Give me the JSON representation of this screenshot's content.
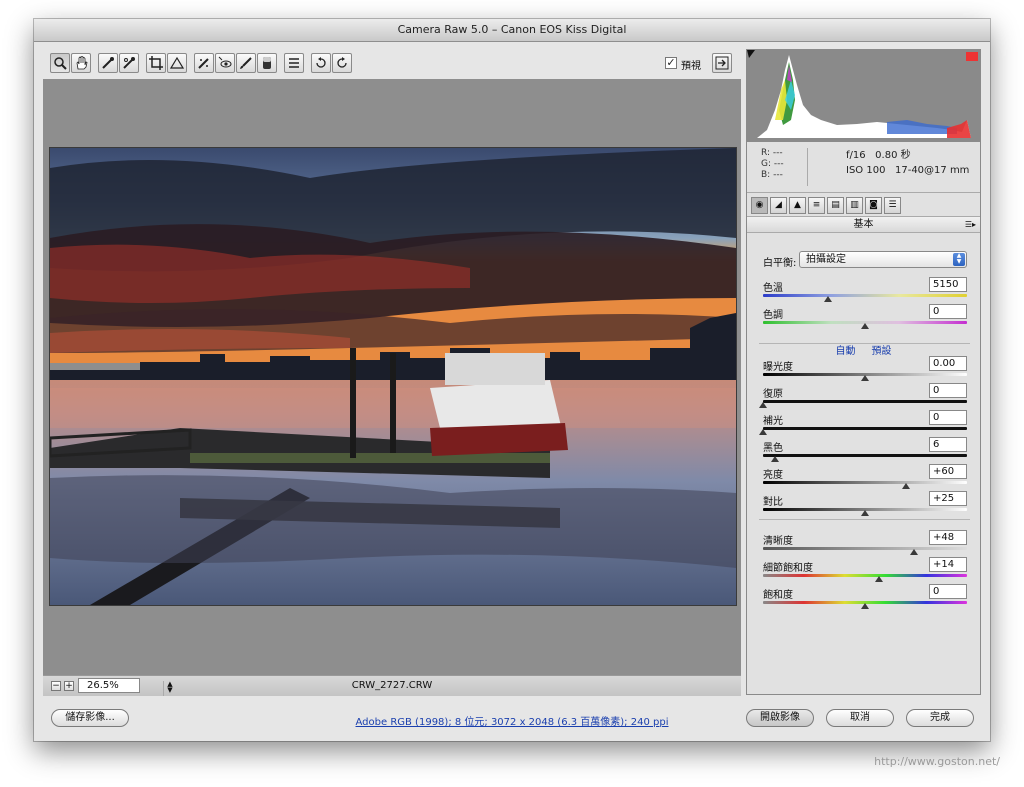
{
  "window": {
    "title": "Camera Raw 5.0  –  Canon EOS Kiss Digital"
  },
  "toolbar": {
    "tools": [
      "zoom-icon",
      "hand-icon",
      "white-balance-eyedropper-icon",
      "color-sampler-icon",
      "crop-icon",
      "straighten-icon",
      "spot-removal-icon",
      "red-eye-icon",
      "adjustment-brush-icon",
      "graduated-filter-icon",
      "preferences-icon",
      "rotate-ccw-icon",
      "rotate-cw-icon"
    ],
    "preview_label": "預視",
    "preview_checked": true
  },
  "status": {
    "zoom_minus": "−",
    "zoom_plus": "+",
    "zoom_value": "26.5%",
    "filename": "CRW_2727.CRW"
  },
  "info": {
    "r_label": "R:",
    "r_value": "---",
    "g_label": "G:",
    "g_value": "---",
    "b_label": "B:",
    "b_value": "---",
    "aperture": "f/16",
    "shutter": "0.80 秒",
    "iso": "ISO 100",
    "lens": "17-40@17 mm"
  },
  "panel": {
    "section_title": "基本",
    "wb_label": "白平衡:",
    "wb_value": "拍攝設定",
    "auto_label": "自動",
    "default_label": "預設",
    "sliders": [
      {
        "label": "色溫",
        "value": "5150",
        "position": 0.32
      },
      {
        "label": "色調",
        "value": "0",
        "position": 0.5
      },
      {
        "label": "曝光度",
        "value": "0.00",
        "position": 0.5
      },
      {
        "label": "復原",
        "value": "0",
        "position": 0.0
      },
      {
        "label": "補光",
        "value": "0",
        "position": 0.0
      },
      {
        "label": "黑色",
        "value": "6",
        "position": 0.06
      },
      {
        "label": "亮度",
        "value": "+60",
        "position": 0.7
      },
      {
        "label": "對比",
        "value": "+25",
        "position": 0.5
      },
      {
        "label": "清晰度",
        "value": "+48",
        "position": 0.74
      },
      {
        "label": "細節飽和度",
        "value": "+14",
        "position": 0.57
      },
      {
        "label": "飽和度",
        "value": "0",
        "position": 0.5
      }
    ]
  },
  "footer": {
    "save_label": "儲存影像...",
    "workflow_text": "Adobe RGB (1998); 8 位元; 3072 x 2048 (6.3 百萬像素); 240 ppi",
    "open_label": "開啟影像",
    "cancel_label": "取消",
    "done_label": "完成"
  },
  "watermark": "http://www.goston.net/"
}
